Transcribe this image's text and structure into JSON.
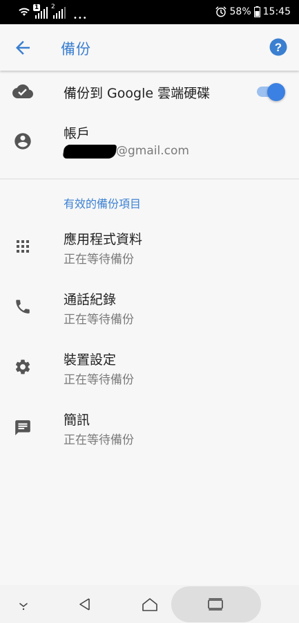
{
  "status_bar": {
    "sim1_badge": "1",
    "sim2_badge": "2",
    "battery_percent": "58%",
    "time": "15:45",
    "icons": [
      "wifi-icon",
      "signal-icon",
      "signal-icon",
      "alarm-icon",
      "battery-icon"
    ]
  },
  "app_bar": {
    "title": "備份",
    "back_icon": "arrow-left-icon",
    "help_icon": "help-circle-icon"
  },
  "backup_toggle": {
    "label": "備份到 Google 雲端硬碟",
    "enabled": true,
    "icon": "cloud-check-icon"
  },
  "account": {
    "label": "帳戶",
    "email_visible_part": "@gmail.com",
    "icon": "account-circle-icon"
  },
  "section": {
    "header": "有效的備份項目"
  },
  "items": [
    {
      "title": "應用程式資料",
      "status": "正在等待備份",
      "icon": "apps-grid-icon"
    },
    {
      "title": "通話紀錄",
      "status": "正在等待備份",
      "icon": "phone-icon"
    },
    {
      "title": "裝置設定",
      "status": "正在等待備份",
      "icon": "gear-icon"
    },
    {
      "title": "簡訊",
      "status": "正在等待備份",
      "icon": "message-icon"
    }
  ],
  "colors": {
    "accent": "#3b7fd0",
    "toggle_on": "#3b80e3",
    "text_primary": "#222222",
    "text_secondary": "#7a7a7a",
    "background": "#f7f7f7"
  }
}
